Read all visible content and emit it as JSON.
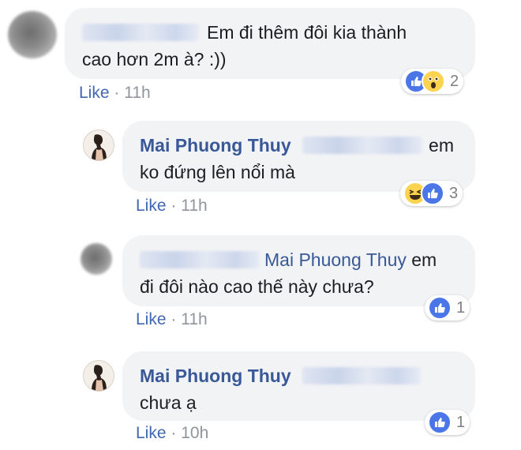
{
  "comments": [
    {
      "text_lines": [
        "Em đi thêm đôi kia thành",
        "cao hơn 2m à? :))"
      ],
      "reaction_count": "2",
      "reactions": [
        "like-icon",
        "wow-icon"
      ],
      "like_label": "Like",
      "time": "11h"
    },
    {
      "author": "Mai Phuong Thuy",
      "text_tail": "em",
      "text_line2": "ko đứng lên nổi mà",
      "reaction_count": "3",
      "reactions": [
        "haha-icon",
        "like-icon"
      ],
      "like_label": "Like",
      "time": "11h"
    },
    {
      "mention": "Mai Phuong Thuy",
      "text_tail": "em",
      "text_line2": "đi đôi nào cao thế này chưa?",
      "reaction_count": "1",
      "reactions": [
        "like-icon"
      ],
      "like_label": "Like",
      "time": "11h"
    },
    {
      "author": "Mai Phuong Thuy",
      "text_line2": "chưa ạ",
      "reaction_count": "1",
      "reactions": [
        "like-icon"
      ],
      "like_label": "Like",
      "time": "10h"
    }
  ],
  "meta_separator": "·",
  "colors": {
    "link_blue": "#385898",
    "like_blue": "#4267b2",
    "bubble_bg": "#f2f3f5",
    "meta_gray": "#90949c"
  }
}
